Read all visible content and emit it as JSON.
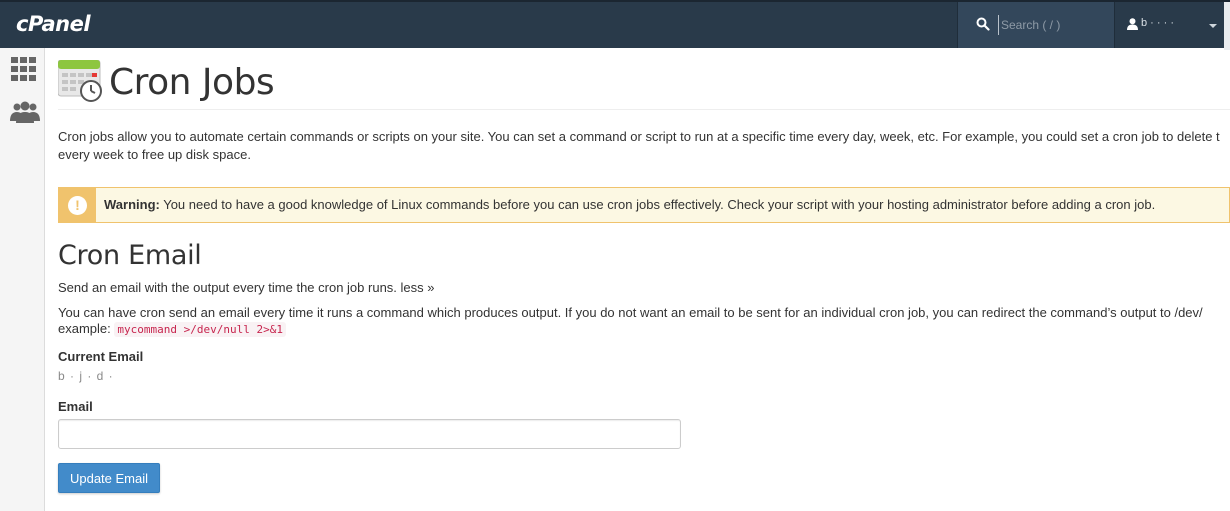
{
  "header": {
    "logo": "cPanel",
    "search_placeholder": "Search ( / )",
    "user_name": "b     ·  ·  ·  ·",
    "icons": {
      "search": "search-icon",
      "user": "user-icon",
      "caret": "caret-down-icon"
    }
  },
  "sidebar": {
    "items": [
      {
        "icon": "grid-icon"
      },
      {
        "icon": "users-icon"
      }
    ]
  },
  "page": {
    "title": "Cron Jobs",
    "icon": "cron-calendar-clock-icon",
    "intro_line1": "Cron jobs allow you to automate certain commands or scripts on your site. You can set a command or script to run at a specific time every day, week, etc. For example, you could set a cron job to delete t",
    "intro_line2": "every week to free up disk space."
  },
  "warning": {
    "label": "Warning:",
    "text": " You need to have a good knowledge of Linux commands before you can use cron jobs effectively. Check your script with your hosting administrator before adding a cron job.",
    "icon": "exclamation-icon",
    "color": "#f0c36d"
  },
  "cron_email": {
    "title": "Cron Email",
    "send_text": "Send an email with the output every time the cron job runs.",
    "less_link": "less »",
    "desc_line1": "You can have cron send an email every time it runs a command which produces output. If you do not want an email to be sent for an individual cron job, you can redirect the command’s output to /dev/",
    "desc_prefix": "example:",
    "desc_code": "mycommand >/dev/null 2>&1",
    "current_email_label": "Current Email",
    "current_email_value": "b · j · d ·",
    "email_label": "Email",
    "email_value": "",
    "button_label": "Update Email",
    "button_color": "#428bca"
  }
}
